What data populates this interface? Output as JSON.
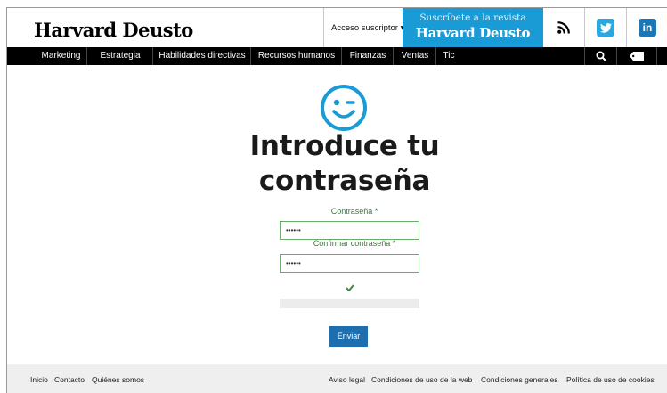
{
  "header": {
    "logo": "Harvard Deusto",
    "subscriber_access": "Acceso suscriptor",
    "subscribe_line1": "Suscríbete a la revista",
    "subscribe_line2": "Harvard Deusto",
    "linkedin_glyph": "in",
    "twitter_color": "#2aa9e0",
    "linkedin_color": "#1b77b5",
    "subscribe_color": "#1a9bd6"
  },
  "nav": {
    "items": [
      "Marketing",
      "Estrategia",
      "Habilidades directivas",
      "Recursos humanos",
      "Finanzas",
      "Ventas",
      "Tic"
    ],
    "icons": [
      "search-icon",
      "tag-icon"
    ]
  },
  "main": {
    "title_line1": "Introduce tu",
    "title_line2": "contraseña",
    "password_label": "Contraseña",
    "password_value": "••••••",
    "confirm_label": "Confirmar contraseña",
    "confirm_value": "••••••",
    "required_mark": "*",
    "submit_label": "Enviar",
    "accent_color": "#1a9bd6"
  },
  "footer": {
    "left_links": [
      "Inicio",
      "Contacto",
      "Quiénes somos"
    ],
    "right_links": [
      "Aviso legal",
      "Condiciones de uso de la web",
      "Condiciones generales",
      "Política de uso de cookies"
    ]
  }
}
